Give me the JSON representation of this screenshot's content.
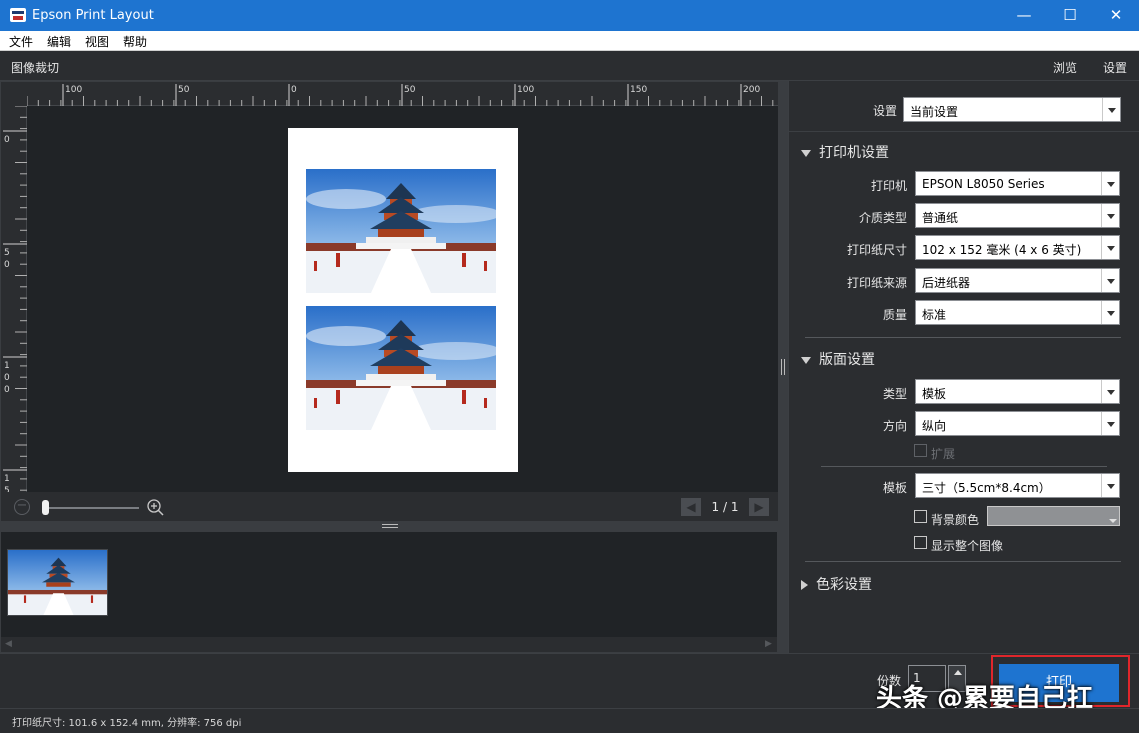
{
  "window": {
    "title": "Epson Print Layout",
    "min": "—",
    "max": "☐",
    "close": "✕"
  },
  "menu": [
    "文件",
    "编辑",
    "视图",
    "帮助"
  ],
  "toolbar": {
    "left": "图像裁切",
    "browse": "浏览",
    "settings": "设置"
  },
  "ruler": {
    "top_labels": [
      "100",
      "50",
      "0",
      "50",
      "100",
      "150",
      "200"
    ],
    "left_labels": [
      "0",
      "5\n0",
      "1\n0\n0",
      "1\n5"
    ]
  },
  "zoom": {
    "value": 0.03
  },
  "pagination": {
    "label": "1 / 1",
    "prev": "◀",
    "next": "▶"
  },
  "panel": {
    "settings_label": "设置",
    "settings_value": "当前设置",
    "printer_section": "打印机设置",
    "printer_label": "打印机",
    "printer_value": "EPSON L8050 Series",
    "media_label": "介质类型",
    "media_value": "普通纸",
    "paper_size_label": "打印纸尺寸",
    "paper_size_value": "102 x 152 毫米 (4 x 6 英寸)",
    "paper_source_label": "打印纸来源",
    "paper_source_value": "后进纸器",
    "quality_label": "质量",
    "quality_value": "标准",
    "layout_section": "版面设置",
    "type_label": "类型",
    "type_value": "模板",
    "orientation_label": "方向",
    "orientation_value": "纵向",
    "expand_label": "扩展",
    "template_label": "模板",
    "template_value": "三寸（5.5cm*8.4cm）",
    "bg_color_label": "背景颜色",
    "show_whole_label": "显示整个图像",
    "color_section": "色彩设置"
  },
  "bottom": {
    "copies_label": "份数",
    "copies_value": "1",
    "print_label": "打印"
  },
  "watermark": "头条 @累要自己扛",
  "status": "打印纸尺寸: 101.6 x 152.4 mm,   分辨率: 756 dpi",
  "colors": {
    "accent": "#1e74d0",
    "highlight": "#e0262b",
    "panel": "#2b2d30"
  }
}
